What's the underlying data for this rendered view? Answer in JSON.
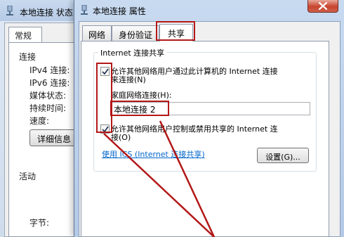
{
  "status_window": {
    "title": "本地连接 状态",
    "tab_general": "常规",
    "connection_heading": "连接",
    "rows": [
      "IPv4 连接:",
      "IPv6 连接:",
      "媒体状态:",
      "持续时间:",
      "速度:"
    ],
    "details_button": "详细信息",
    "activity_heading": "活动",
    "bytes_label": "字节:"
  },
  "properties_window": {
    "title": "本地连接 属性",
    "tabs": [
      "网络",
      "身份验证",
      "共享"
    ],
    "active_tab": "共享",
    "group_title": "Internet 连接共享",
    "option_allow_share": {
      "line1": "允许其他网络用户通过此计算机的 Internet 连接",
      "line2": "来连接(N)",
      "checked": true
    },
    "home_connection_label": "家庭网络连接(H):",
    "home_connection_value": "本地连接 2",
    "option_allow_control": {
      "line1": "允许其他网络用户控制或禁用共享的 Internet 连",
      "line2": "接(O)",
      "checked": true
    },
    "ics_link": "使用 ICS (Internet 连接共享)",
    "settings_button": "设置(G)..."
  },
  "colors": {
    "annotation": "#b31818",
    "link": "#0066cc",
    "close_button": "#c7452f"
  }
}
